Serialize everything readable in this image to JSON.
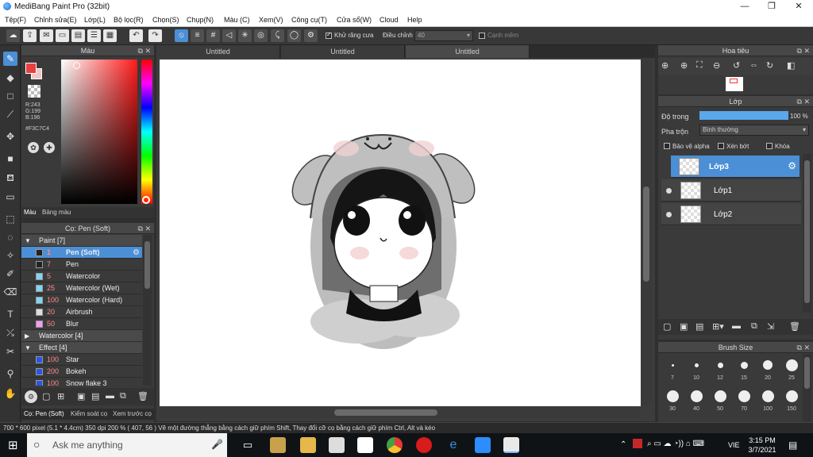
{
  "window": {
    "title": "MediBang Paint Pro (32bit)",
    "minimize": "—",
    "maximize": "❐",
    "close": "✕"
  },
  "menu": [
    "Tệp(F)",
    "Chỉnh sửa(E)",
    "Lớp(L)",
    "Bộ lọc(R)",
    "Chọn(S)",
    "Chụp(N)",
    "Màu (C)",
    "Xem(V)",
    "Công cụ(T)",
    "Cửa sổ(W)",
    "Cloud",
    "Help"
  ],
  "toolbar": {
    "antialias_label": "Khử răng cưa",
    "correction_label": "Điều chỉnh",
    "correction_value": "40",
    "sharp_edge_label": "Cạnh mềm"
  },
  "color_panel": {
    "title": "Màu",
    "r": "R:243",
    "g": "G:199",
    "b": "B:196",
    "hex": "#F3C7C4",
    "fg_color": "#e83f3f",
    "bg_color": "#f3c7c4",
    "tab_color": "Màu",
    "tab_palette": "Bảng màu"
  },
  "brush_panel": {
    "title": "Cọ: Pen (Soft)",
    "rows": [
      {
        "type": "group",
        "name": "Paint [7]",
        "arrow": "▼"
      },
      {
        "type": "item",
        "size": "1",
        "name": "Pen (Soft)",
        "color": "#222222",
        "selected": true
      },
      {
        "type": "item",
        "size": "7",
        "name": "Pen",
        "color": "#222222"
      },
      {
        "type": "item",
        "size": "5",
        "name": "Watercolor",
        "color": "#7fd6f5"
      },
      {
        "type": "item",
        "size": "25",
        "name": "Watercolor (Wet)",
        "color": "#7fd6f5"
      },
      {
        "type": "item",
        "size": "100",
        "name": "Watercolor (Hard)",
        "color": "#7fd6f5"
      },
      {
        "type": "item",
        "size": "20",
        "name": "Airbrush",
        "color": "#dddddd"
      },
      {
        "type": "item",
        "size": "50",
        "name": "Blur",
        "color": "#f39cf0"
      },
      {
        "type": "group",
        "name": "Watercolor [4]",
        "arrow": "▶"
      },
      {
        "type": "group",
        "name": "Effect [4]",
        "arrow": "▼"
      },
      {
        "type": "item",
        "size": "100",
        "name": "Star",
        "color": "#2a56e6"
      },
      {
        "type": "item",
        "size": "200",
        "name": "Bokeh",
        "color": "#2a56e6"
      },
      {
        "type": "item",
        "size": "100",
        "name": "Snow flake 3",
        "color": "#2a56e6"
      }
    ],
    "tabs": [
      "Cọ: Pen (Soft)",
      "Kiểm soát cọ",
      "Xem trước cọ"
    ]
  },
  "canvas": {
    "tabs": [
      "Untitled",
      "Untitled",
      "Untitled"
    ]
  },
  "navigator": {
    "title": "Hoa tiêu"
  },
  "layer_panel": {
    "title": "Lớp",
    "opacity_label": "Độ trong",
    "opacity_value": "100 %",
    "opacity_fraction": 1.0,
    "blend_label": "Pha trộn",
    "blend_value": "Bình thường",
    "protect_alpha": "Bảo vệ alpha",
    "clipping": "Xén bớt",
    "lock": "Khóa",
    "layers": [
      {
        "name": "Lớp3",
        "selected": true
      },
      {
        "name": "Lớp1",
        "selected": false
      },
      {
        "name": "Lớp2",
        "selected": false
      }
    ]
  },
  "brush_size": {
    "title": "Brush Size",
    "row1": [
      "7",
      "10",
      "12",
      "15",
      "20",
      "25"
    ],
    "row2": [
      "30",
      "40",
      "50",
      "70",
      "100",
      "150"
    ]
  },
  "status": "700 * 600 pixel   (5.1 * 4.4cm)   350 dpi   200 %   ( 407, 56 )   Vẽ một đường thẳng bằng cách giữ phím Shift, Thay đổi cỡ cọ bằng cách giữ phím Ctrl, Alt và kéo",
  "taskbar": {
    "search_placeholder": "Ask me anything",
    "lang": "VIE",
    "time": "3:15 PM",
    "date": "3/7/2021"
  }
}
